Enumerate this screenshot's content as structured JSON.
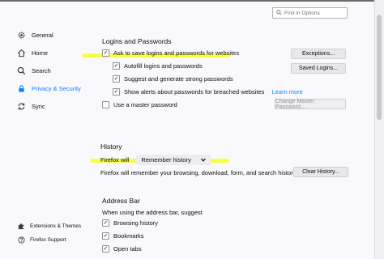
{
  "search": {
    "placeholder": "Find in Options",
    "icon": "search-icon"
  },
  "sidebar": {
    "items": [
      {
        "label": "General",
        "icon": "gear-icon"
      },
      {
        "label": "Home",
        "icon": "home-icon"
      },
      {
        "label": "Search",
        "icon": "search-icon"
      },
      {
        "label": "Privacy & Security",
        "icon": "lock-icon",
        "selected": true
      },
      {
        "label": "Sync",
        "icon": "sync-icon"
      }
    ],
    "footer": [
      {
        "label": "Extensions & Themes",
        "icon": "puzzle-icon"
      },
      {
        "label": "Firefox Support",
        "icon": "help-icon"
      }
    ]
  },
  "logins": {
    "heading": "Logins and Passwords",
    "ask_save": {
      "label": "Ask to save logins and passwords for websites",
      "checked": true
    },
    "autofill": {
      "label": "Autofill logins and passwords",
      "checked": true
    },
    "suggest": {
      "label": "Suggest and generate strong passwords",
      "checked": true
    },
    "alerts": {
      "label": "Show alerts about passwords for breached websites",
      "checked": true
    },
    "learn_more": "Learn more",
    "master": {
      "label": "Use a master password",
      "checked": false
    },
    "exceptions_button": "Exceptions...",
    "saved_logins_button": "Saved Logins...",
    "change_master_button": "Change Master Password..."
  },
  "history": {
    "heading": "History",
    "firefox_will_label": "Firefox will",
    "mode_selected": "Remember history",
    "description": "Firefox will remember your browsing, download, form, and search history.",
    "clear_button": "Clear History..."
  },
  "address_bar": {
    "heading": "Address Bar",
    "description": "When using the address bar, suggest",
    "items": [
      {
        "label": "Browsing history",
        "checked": true
      },
      {
        "label": "Bookmarks",
        "checked": true
      },
      {
        "label": "Open tabs",
        "checked": true
      }
    ]
  },
  "colors": {
    "accent": "#0a84ff",
    "highlight": "#f5ff3b"
  }
}
